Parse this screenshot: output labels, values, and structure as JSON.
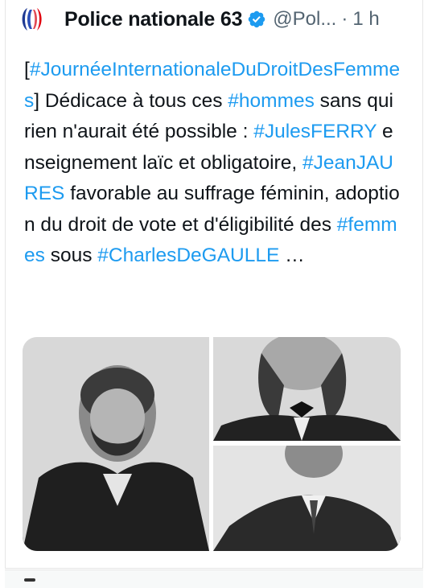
{
  "tweet": {
    "author_name": "Police nationale 63",
    "handle": "@Pol...",
    "time": "1 h",
    "body": [
      {
        "t": "[",
        "tag": false
      },
      {
        "t": "#JournéeInternationaleDuDroitDesFemmes",
        "tag": true
      },
      {
        "t": "] Dédicace à tous ces ",
        "tag": false
      },
      {
        "t": "#hommes",
        "tag": true
      },
      {
        "t": " sans qui rien n'aurait été possible : ",
        "tag": false
      },
      {
        "t": "#JulesFERRY",
        "tag": true
      },
      {
        "t": " enseignement laïc et obligatoire, ",
        "tag": false
      },
      {
        "t": "#JeanJAURES",
        "tag": true
      },
      {
        "t": " favorable au suffrage féminin, adoption du droit de vote et d'éligibilité des ",
        "tag": false
      },
      {
        "t": "#femmes",
        "tag": true
      },
      {
        "t": " sous ",
        "tag": false
      },
      {
        "t": "#CharlesDeGAULLE",
        "tag": true
      },
      {
        "t": " …",
        "tag": false
      }
    ]
  },
  "colors": {
    "link": "#1d9bf0",
    "verified": "#1d9bf0",
    "text": "#0f1419",
    "muted": "#536471"
  },
  "icons": {
    "verified": "verified-badge-icon",
    "avatar": "police-nationale-logo"
  }
}
